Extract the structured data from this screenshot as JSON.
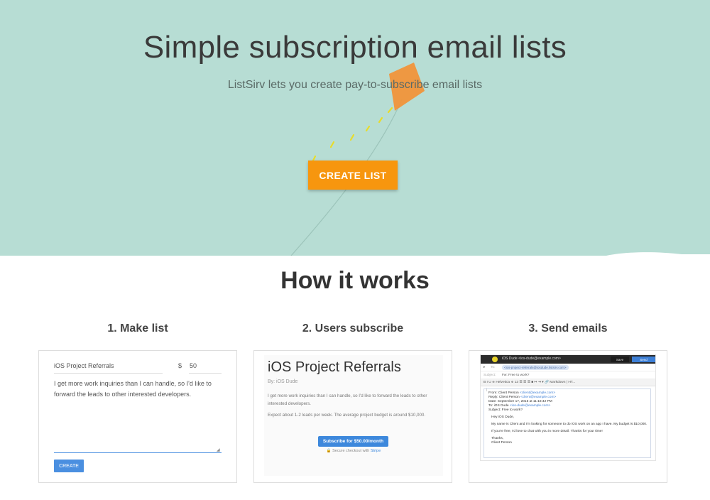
{
  "hero": {
    "title": "Simple subscription email lists",
    "subtitle": "ListSirv lets you create pay-to-subscribe email lists",
    "cta_label": "CREATE LIST",
    "background_color": "#b7ddd4",
    "cta_color": "#f7960e",
    "kite_color": "#f0943a"
  },
  "how_it_works": {
    "title": "How it works",
    "steps": [
      {
        "heading": "1. Make list",
        "list_name": "iOS Project Referrals",
        "currency": "$",
        "price": "50",
        "description": "I get more work inquiries than I can handle, so I'd like to forward the leads to other interested developers.",
        "button_label": "CREATE"
      },
      {
        "heading": "2. Users subscribe",
        "list_title": "iOS Project Referrals",
        "byline": "By: iOS Dude",
        "description": "I get more work inquiries than I can handle, so I'd like to forward the leads to other interested developers.",
        "expectation": "Expect about 1-2 leads per week. The average project budget is around $10,000.",
        "subscribe_label": "Subscribe for $50.00/month",
        "secure_text": "Secure checkout with",
        "secure_brand": "Stripe"
      },
      {
        "heading": "3. Send emails",
        "from_account": "iOS Dude <ios-dude@example.com>",
        "save_label": "Save",
        "send_label": "Send",
        "to_label": "To:",
        "to_value": "<ios-project-referrals@iosdude.listsirv.com>",
        "subject_label": "Subject:",
        "subject_value": "Fw: Free to work?",
        "toolbar": "B   I   U   ≑ Helvetica   ≑ 13   ☰   ☰   ☰   ■   ↦ ⇥ ▾   🔗   Markdown  |  HT...",
        "forward": {
          "from_line": "From: Client Person",
          "from_email": "<client@example.com>",
          "reply_line": "Reply: Client Person",
          "reply_email": "<client@example.com>",
          "date_line": "Date: September 17, 2015 at 11:18:42 PM",
          "to_line": "To: iOS Dude",
          "to_email": "<ios-dude@example.com>",
          "subject_line": "Subject:  Free to work?"
        },
        "body": {
          "greeting": "Hey iOS Dude,",
          "para1": "My name is Client and I'm looking for someone to do iOS work on an app I have. My budget is $10,000.",
          "para2": "If you're free, I'd love to chat with you in more detail. Thanks for your time!",
          "signoff": "Thanks,",
          "signature": "Client Person"
        }
      }
    ]
  }
}
